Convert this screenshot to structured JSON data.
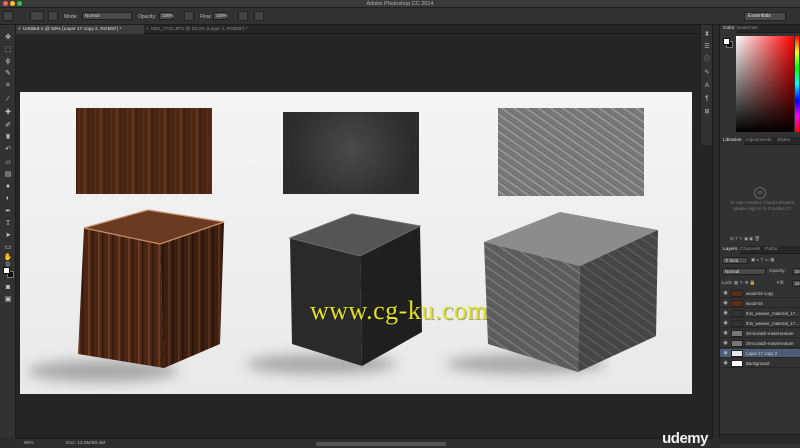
{
  "app": {
    "title": "Adobe Photoshop CC 2014"
  },
  "options_bar": {
    "mode_label": "Mode:",
    "mode_value": "Normal",
    "opacity_label": "Opacity:",
    "opacity_value": "100%",
    "flow_label": "Flow:",
    "flow_value": "100%",
    "workspace": "Essentials"
  },
  "document_tabs": [
    {
      "label": "Untitled-1 @ 50% (Layer 17 copy 2, RGB/8*) *",
      "active": true
    },
    {
      "label": "IMG_7731.JPG @ 33.3% (Layer 2, RGB/8*) *",
      "active": false
    }
  ],
  "canvas": {
    "watermark": "www.cg-ku.com"
  },
  "status_bar": {
    "zoom": "50%",
    "doc_info": "Doc: 13.5M/80.4M",
    "brand": "udemy"
  },
  "color_panel": {
    "tabs": [
      "Color",
      "Swatches"
    ],
    "fg_color": "#ffffff",
    "bg_color": "#111111",
    "field_hue": "#ff0000"
  },
  "libraries_panel": {
    "tabs": [
      "Libraries",
      "Adjustments",
      "Styles"
    ],
    "empty_message": "To use Creative Cloud Libraries please sign in to Creative Cl"
  },
  "layers_panel": {
    "tabs": [
      "Layers",
      "Channels",
      "Paths"
    ],
    "kind_filter": "Kind",
    "blend_mode": "Normal",
    "opacity_label": "Opacity:",
    "opacity_value": "10",
    "lock_label": "Lock:",
    "fill_label": "Fill:",
    "fill_value": "10",
    "layers": [
      {
        "name": "wood-04 copy",
        "selected": false
      },
      {
        "name": "wood-04",
        "selected": false
      },
      {
        "name": "thin_weaver_material_17...",
        "selected": false
      },
      {
        "name": "thin_weaver_material_17...",
        "selected": false
      },
      {
        "name": "20-scratch-metal-texture",
        "selected": false
      },
      {
        "name": "20-scratch-metal-texture",
        "selected": false
      },
      {
        "name": "Layer 17 copy 2",
        "selected": true
      },
      {
        "name": "Background",
        "selected": false
      }
    ]
  },
  "toolbox": {
    "tools": [
      "move-tool",
      "marquee-tool",
      "lasso-tool",
      "quick-select-tool",
      "crop-tool",
      "eyedropper-tool",
      "healing-tool",
      "brush-tool",
      "clone-stamp-tool",
      "history-brush-tool",
      "eraser-tool",
      "gradient-tool",
      "blur-tool",
      "dodge-tool",
      "pen-tool",
      "type-tool",
      "path-select-tool",
      "shape-tool",
      "hand-tool",
      "zoom-tool"
    ]
  }
}
